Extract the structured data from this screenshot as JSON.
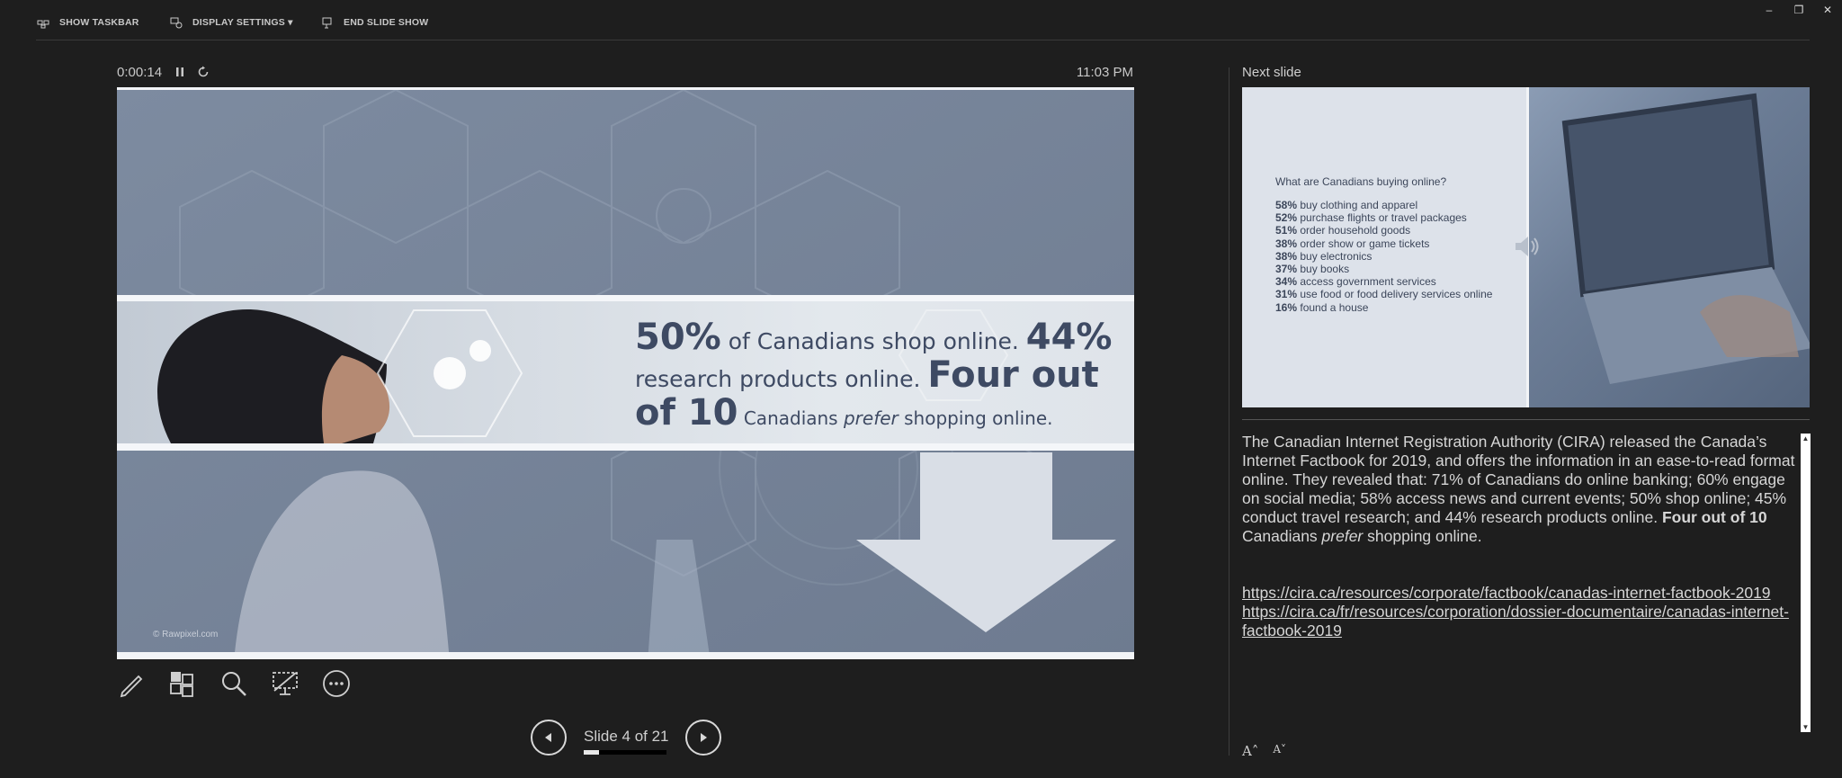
{
  "toolbar": {
    "show_taskbar": "SHOW TASKBAR",
    "display_settings": "DISPLAY SETTINGS ▾",
    "end_slide_show": "END SLIDE SHOW"
  },
  "window_controls": {
    "minimize": "–",
    "restore": "❐",
    "close": "✕"
  },
  "timer": {
    "elapsed": "0:00:14",
    "clock": "11:03 PM"
  },
  "current_slide": {
    "headline_pct1": "50%",
    "headline_t1": " of Canadians shop online. ",
    "headline_pct2": "44%",
    "headline_t2": "research products online. ",
    "headline_four": "Four out",
    "headline_of10": "of 10",
    "headline_t3a": " Canadians ",
    "headline_prefer": "prefer",
    "headline_t3b": " shopping online.",
    "credit": "© Rawpixel.com"
  },
  "tools": [
    "pen-tool",
    "see-all-slides",
    "zoom",
    "black-screen",
    "more-options"
  ],
  "navigation": {
    "label": "Slide 4 of 21",
    "progress": 0.19
  },
  "next_slide": {
    "title": "Next slide",
    "question": "What are Canadians buying online?",
    "stats": [
      {
        "pct": "58%",
        "text": " buy clothing and apparel"
      },
      {
        "pct": "52%",
        "text": " purchase flights or travel packages"
      },
      {
        "pct": "51%",
        "text": " order household goods"
      },
      {
        "pct": "38%",
        "text": " order show or game tickets"
      },
      {
        "pct": "38%",
        "text": " buy electronics"
      },
      {
        "pct": "37%",
        "text": " buy books"
      },
      {
        "pct": "34%",
        "text": " access government services"
      },
      {
        "pct": "31%",
        "text": " use food or food delivery services online"
      },
      {
        "pct": "16%",
        "text": " found a house"
      }
    ]
  },
  "notes": {
    "text1": "The Canadian Internet Registration Authority (CIRA) released the Canada’s Internet Factbook for 2019, and offers the information in an ease-to-read format online. They revealed that: 71% of Canadians do online banking; 60% engage on social media; 58% access news and current events; 50% shop online; 45% conduct travel research; and 44% research products online. ",
    "bold": "Four out of 10",
    "text2": " Canadians ",
    "italic": "prefer",
    "text3": " shopping online.",
    "link1": "https://cira.ca/resources/corporate/factbook/canadas-internet-factbook-2019",
    "link2": "https://cira.ca/fr/resources/corporation/dossier-documentaire/canadas-internet-factbook-2019"
  },
  "font_buttons": {
    "increase": "A˄",
    "decrease": "A˅"
  }
}
